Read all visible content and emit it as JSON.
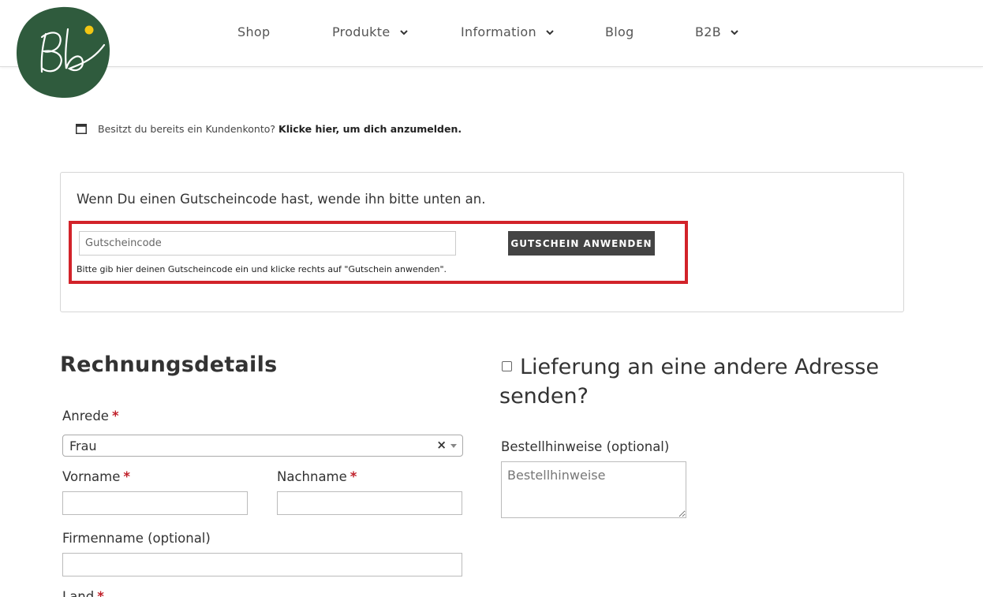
{
  "header": {
    "logo_text": "Bb",
    "logo_bg": "#2f5b3d",
    "logo_dot": "#f3c613",
    "nav": [
      {
        "label": "Shop"
      },
      {
        "label": "Produkte"
      },
      {
        "label": "Information"
      },
      {
        "label": "Blog"
      },
      {
        "label": "B2B"
      }
    ]
  },
  "login_notice": {
    "text": "Besitzt du bereits ein Kundenkonto?",
    "link": "Klicke hier, um dich anzumelden."
  },
  "coupon": {
    "title": "Wenn Du einen Gutscheincode hast, wende ihn bitte unten an.",
    "placeholder": "Gutscheincode",
    "button": "GUTSCHEIN ANWENDEN",
    "hint": "Bitte gib hier deinen Gutscheincode ein und klicke rechts auf \"Gutschein anwenden\".",
    "highlight_color": "#d2232a"
  },
  "billing": {
    "title": "Rechnungsdetails",
    "anrede_label": "Anrede",
    "anrede_value": "Frau",
    "clear_symbol": "×",
    "vorname_label": "Vorname",
    "nachname_label": "Nachname",
    "firma_label": "Firmenname (optional)",
    "land_label": "Land",
    "required_mark": "*"
  },
  "shipping": {
    "title": "Lieferung an eine andere Adresse senden?",
    "notes_label": "Bestellhinweise (optional)",
    "notes_placeholder": "Bestellhinweise"
  }
}
